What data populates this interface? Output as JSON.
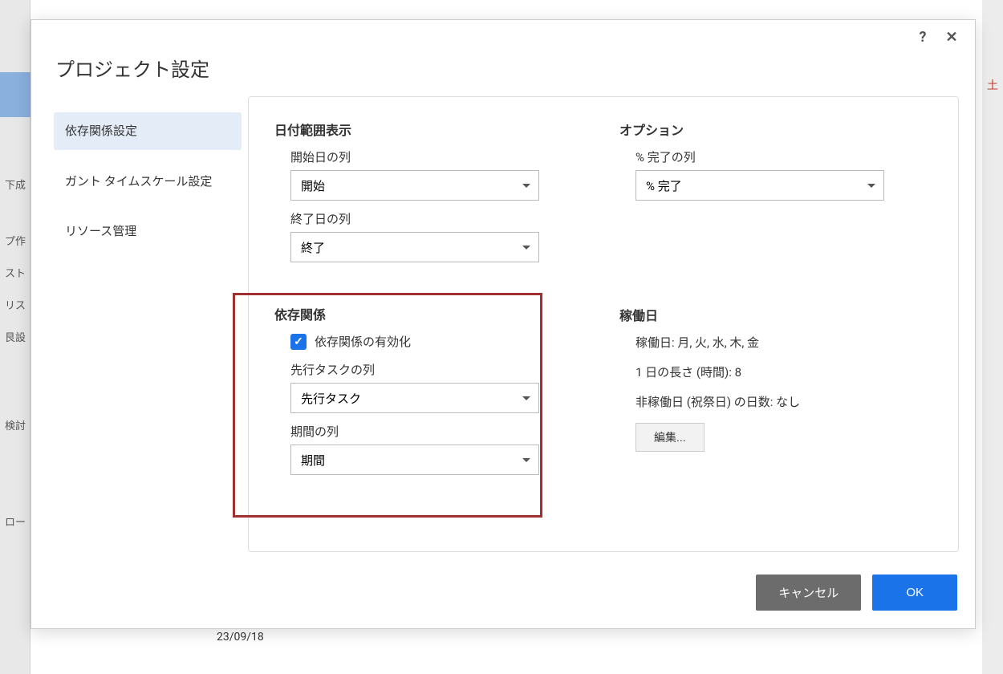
{
  "dialog": {
    "title": "プロジェクト設定",
    "help_icon": "?",
    "close_icon": "✕"
  },
  "sidebar": {
    "items": [
      {
        "label": "依存関係設定",
        "active": true
      },
      {
        "label": "ガント タイムスケール設定",
        "active": false
      },
      {
        "label": "リソース管理",
        "active": false
      }
    ]
  },
  "date_range": {
    "heading": "日付範囲表示",
    "start_label": "開始日の列",
    "start_value": "開始",
    "end_label": "終了日の列",
    "end_value": "終了"
  },
  "options": {
    "heading": "オプション",
    "percent_label": "% 完了の列",
    "percent_value": "% 完了"
  },
  "dependencies": {
    "heading": "依存関係",
    "enable_label": "依存関係の有効化",
    "predecessor_label": "先行タスクの列",
    "predecessor_value": "先行タスク",
    "duration_label": "期間の列",
    "duration_value": "期間"
  },
  "workdays": {
    "heading": "稼働日",
    "days_line": "稼働日: 月, 火, 水, 木, 金",
    "day_length_line": "1 日の長さ (時間): 8",
    "nonworking_line": "非稼働日 (祝祭日) の日数: なし",
    "edit_button": "編集..."
  },
  "footer": {
    "cancel": "キャンセル",
    "ok": "OK"
  },
  "background": {
    "side_texts": [
      "下成",
      "プ作",
      "スト",
      "リス",
      "艮設",
      "検討",
      "ロー"
    ],
    "sat": "土",
    "date_cell": "23/09/18"
  }
}
